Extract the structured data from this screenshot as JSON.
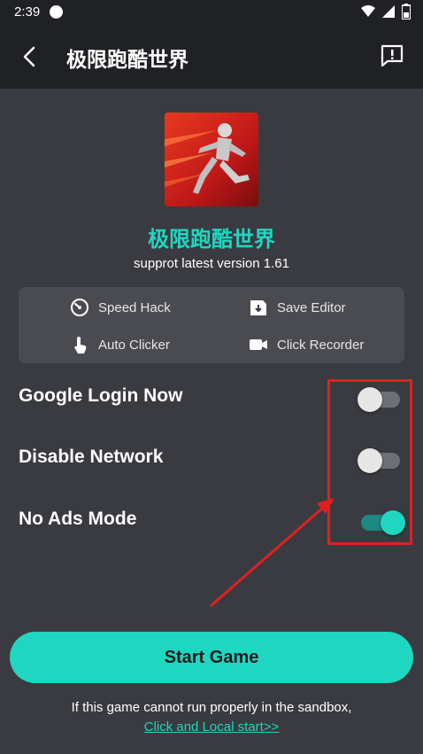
{
  "status_bar": {
    "time": "2:39"
  },
  "app_bar": {
    "title": "极限跑酷世界"
  },
  "game": {
    "name": "极限跑酷世界",
    "version_text": "supprot latest version 1.61"
  },
  "features": [
    {
      "label": "Speed Hack",
      "icon": "speedometer-icon"
    },
    {
      "label": "Save Editor",
      "icon": "save-icon"
    },
    {
      "label": "Auto Clicker",
      "icon": "tap-icon"
    },
    {
      "label": "Click Recorder",
      "icon": "camera-icon"
    }
  ],
  "toggles": [
    {
      "label": "Google Login Now",
      "on": false
    },
    {
      "label": "Disable Network",
      "on": false
    },
    {
      "label": "No Ads Mode",
      "on": true
    }
  ],
  "start_button": {
    "label": "Start Game"
  },
  "footer": {
    "notice": "If this game cannot run properly in the sandbox,",
    "link": "Click and Local start>>"
  },
  "colors": {
    "accent": "#1fd6c1",
    "background": "#3a3b40",
    "app_bar": "#202124",
    "annotation": "#e02020"
  }
}
